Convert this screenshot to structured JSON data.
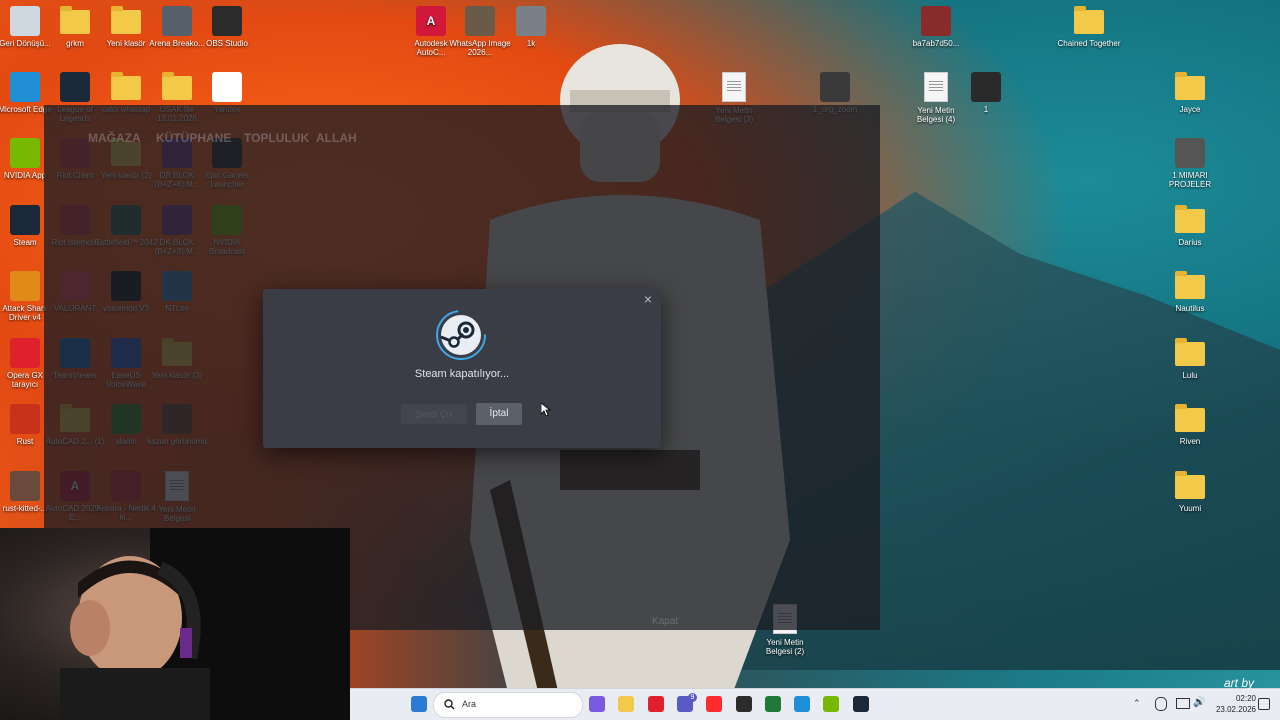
{
  "desktop_icons": [
    {
      "label": "Geri Dönüşü...",
      "kind": "recycle",
      "color": "#cfd8e0"
    },
    {
      "label": "grkm",
      "kind": "folder"
    },
    {
      "label": "Yeni klasör",
      "kind": "folder"
    },
    {
      "label": "Arena Breako...",
      "kind": "app",
      "color": "#56606a"
    },
    {
      "label": "OBS Studio",
      "kind": "app",
      "color": "#2b2b2b"
    },
    {
      "label": "Autodesk AutoC...",
      "kind": "app",
      "color": "#d2183a",
      "glyph": "A"
    },
    {
      "label": "WhatsApp Image 2026...",
      "kind": "image",
      "color": "#6a5a4a"
    },
    {
      "label": "1k",
      "kind": "image",
      "color": "#7a8088"
    },
    {
      "label": "ba7ab7d50...",
      "kind": "image",
      "color": "#8a2a2a"
    },
    {
      "label": "Chained Together",
      "kind": "folder"
    },
    {
      "label": "Microsoft Edge",
      "kind": "app",
      "color": "#1f8fd6"
    },
    {
      "label": "League of Legends",
      "kind": "app",
      "color": "#1a2a3a"
    },
    {
      "label": "calcı whatsap",
      "kind": "folder"
    },
    {
      "label": "USAK file 13.01.2026",
      "kind": "folder"
    },
    {
      "label": "Yandex",
      "kind": "app",
      "color": "#ffffff"
    },
    {
      "label": "Yeni Metin Belgesi (3)",
      "kind": "doc"
    },
    {
      "label": "1_org_zoom",
      "kind": "image",
      "color": "#3a3a3a"
    },
    {
      "label": "Yeni Metin Belgesi (4)",
      "kind": "doc"
    },
    {
      "label": "1",
      "kind": "image",
      "color": "#2a2a2a"
    },
    {
      "label": "Jayce",
      "kind": "folder"
    },
    {
      "label": "NVIDIA App",
      "kind": "app",
      "color": "#76b900"
    },
    {
      "label": "Riot Client",
      "kind": "app",
      "color": "#d13639"
    },
    {
      "label": "Yeni klasör (2)",
      "kind": "folder"
    },
    {
      "label": "DB BLOK (B+Z+4) M...",
      "kind": "app",
      "color": "#7a3a8a"
    },
    {
      "label": "Epic Games Launcher",
      "kind": "app",
      "color": "#2a2a2a"
    },
    {
      "label": "1 MIMARI PROJELER",
      "kind": "app",
      "color": "#555555"
    },
    {
      "label": "Steam",
      "kind": "app",
      "color": "#1b2838"
    },
    {
      "label": "Riot istemcisi",
      "kind": "app",
      "color": "#d13639"
    },
    {
      "label": "Battlefield™ 2042",
      "kind": "app",
      "color": "#2a6a4a"
    },
    {
      "label": "DK BLOK (B+Z+3) M...",
      "kind": "app",
      "color": "#7a3a8a"
    },
    {
      "label": "NVIDIA Broadcast",
      "kind": "app",
      "color": "#76b900"
    },
    {
      "label": "Darius",
      "kind": "folder"
    },
    {
      "label": "Attack Shark Driver v4",
      "kind": "app",
      "color": "#e08a1a"
    },
    {
      "label": "VALORANT",
      "kind": "app",
      "color": "#fa4454"
    },
    {
      "label": "voicemod V3",
      "kind": "app",
      "color": "#1a1a1a"
    },
    {
      "label": "NTLite",
      "kind": "app",
      "color": "#3a8ac6"
    },
    {
      "label": "Nautilus",
      "kind": "folder"
    },
    {
      "label": "Opera GX tarayıcı",
      "kind": "app",
      "color": "#e0202a"
    },
    {
      "label": "TeamViewer",
      "kind": "app",
      "color": "#0e6fc6"
    },
    {
      "label": "EaseUS VoiceWave",
      "kind": "app",
      "color": "#2a5ac6"
    },
    {
      "label": "Yeni klasör (3)",
      "kind": "folder"
    },
    {
      "label": "Lulu",
      "kind": "folder"
    },
    {
      "label": "Rust",
      "kind": "app",
      "color": "#c8321a"
    },
    {
      "label": "AutoCAD 2... (1)",
      "kind": "folder"
    },
    {
      "label": "aladin",
      "kind": "app",
      "color": "#3a8a2a"
    },
    {
      "label": "kazan görünümü",
      "kind": "image",
      "color": "#6a4a3a"
    },
    {
      "label": "Riven",
      "kind": "folder"
    },
    {
      "label": "rust-kitted-...",
      "kind": "image",
      "color": "#6a4a3a"
    },
    {
      "label": "AutoCAD 2025 - E...",
      "kind": "app",
      "color": "#d2183a",
      "glyph": "A"
    },
    {
      "label": "Ankara - Nedik 4 ki...",
      "kind": "app",
      "color": "#c82a2a"
    },
    {
      "label": "Yeni Metin Belgesi",
      "kind": "doc"
    },
    {
      "label": "Yuumi",
      "kind": "folder"
    },
    {
      "label": "Yeni Metin Belgesi (2)",
      "kind": "doc"
    }
  ],
  "steam_nav": [
    "MAĞAZA",
    "KÜTÜPHANE",
    "TOPLULUK",
    "ALLAH"
  ],
  "dialog": {
    "status": "Steam kapatılıyor...",
    "disabled_button": "Şimdi Çık",
    "cancel_button": "İptal",
    "close_glyph": "×"
  },
  "steam_footer": {
    "close_label": "Kapat"
  },
  "taskbar": {
    "search_placeholder": "Ara",
    "apps": [
      {
        "name": "windows-start",
        "color": "#2a7ad6"
      },
      {
        "name": "copilot",
        "color": "#7a5ae0"
      },
      {
        "name": "file-explorer",
        "color": "#f3c94a"
      },
      {
        "name": "opera-gx",
        "color": "#e0202a"
      },
      {
        "name": "teams",
        "color": "#5a5ac6"
      },
      {
        "name": "yandex",
        "color": "#ff2a2a"
      },
      {
        "name": "obs",
        "color": "#2b2b2b"
      },
      {
        "name": "discord",
        "color": "#1f7a3a"
      },
      {
        "name": "edge",
        "color": "#1f8fd6"
      },
      {
        "name": "nvidia",
        "color": "#76b900"
      },
      {
        "name": "steam",
        "color": "#1b2838"
      }
    ],
    "time": "02:20",
    "date": "23.02.2026",
    "teams_badge": "9"
  },
  "watermark": "art by"
}
